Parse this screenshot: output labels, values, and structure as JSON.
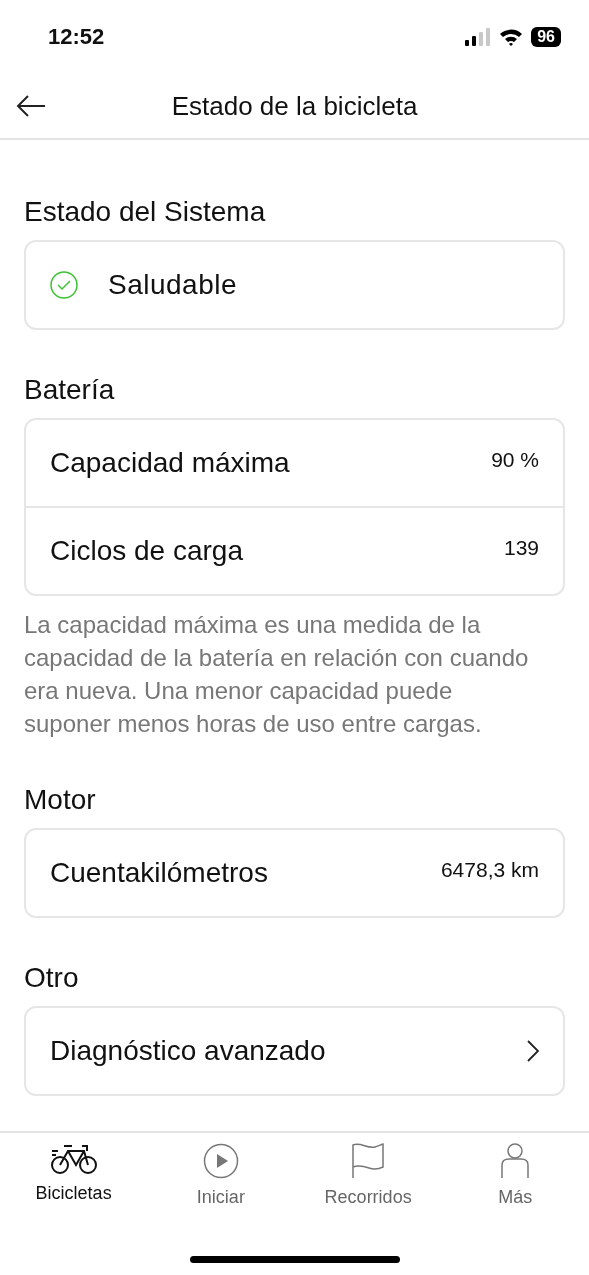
{
  "status_bar": {
    "time": "12:52",
    "battery": "96"
  },
  "header": {
    "title": "Estado de la bicicleta"
  },
  "sections": [
    {
      "title": "Estado del Sistema",
      "kind": "status",
      "status": {
        "label": "Saludable",
        "healthy": true
      }
    },
    {
      "title": "Batería",
      "kind": "rows",
      "rows": [
        {
          "label": "Capacidad máxima",
          "value": "90 %"
        },
        {
          "label": "Ciclos de carga",
          "value": "139"
        }
      ],
      "note": "La capacidad máxima es una medida de la capacidad de la batería en relación con cuando era nueva. Una menor capacidad puede suponer menos horas de uso entre cargas."
    },
    {
      "title": "Motor",
      "kind": "rows",
      "rows": [
        {
          "label": "Cuentakilómetros",
          "value": "6478,3 km"
        }
      ]
    },
    {
      "title": "Otro",
      "kind": "links",
      "rows": [
        {
          "label": "Diagnóstico avanzado"
        }
      ]
    }
  ],
  "tabs": [
    {
      "label": "Bicicletas",
      "kind": "bike",
      "selected": true
    },
    {
      "label": "Iniciar",
      "kind": "play",
      "selected": false
    },
    {
      "label": "Recorridos",
      "kind": "flag",
      "selected": false
    },
    {
      "label": "Más",
      "kind": "person",
      "selected": false
    }
  ]
}
